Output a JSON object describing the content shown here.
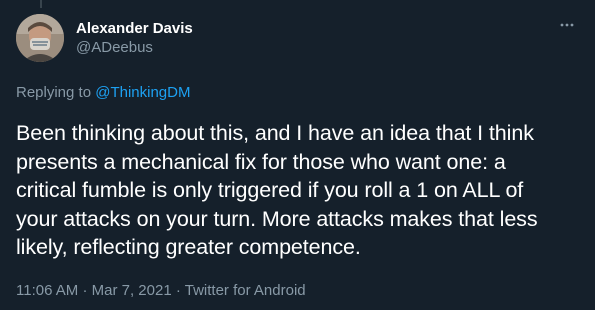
{
  "tweet": {
    "author": {
      "display_name": "Alexander Davis",
      "handle": "@ADeebus"
    },
    "replying_to": {
      "prefix": "Replying to",
      "mention": "@ThinkingDM"
    },
    "text_lines": [
      "Been thinking about this, and I have an idea that I think",
      "presents a mechanical fix for those who want one: a",
      "critical fumble is only triggered if you roll a 1 on ALL of",
      "your attacks on your turn. More attacks makes that less",
      "likely, reflecting greater competence."
    ],
    "meta": {
      "time": "11:06 AM",
      "separator_1": "·",
      "date": "Mar 7, 2021",
      "separator_2": "·",
      "source": "Twitter for Android"
    },
    "more_icon": "more-horizontal-icon"
  },
  "colors": {
    "background": "#15202b",
    "text": "#ffffff",
    "secondary": "#8899a6",
    "link": "#1da1f2",
    "thread_line": "#38444d"
  }
}
